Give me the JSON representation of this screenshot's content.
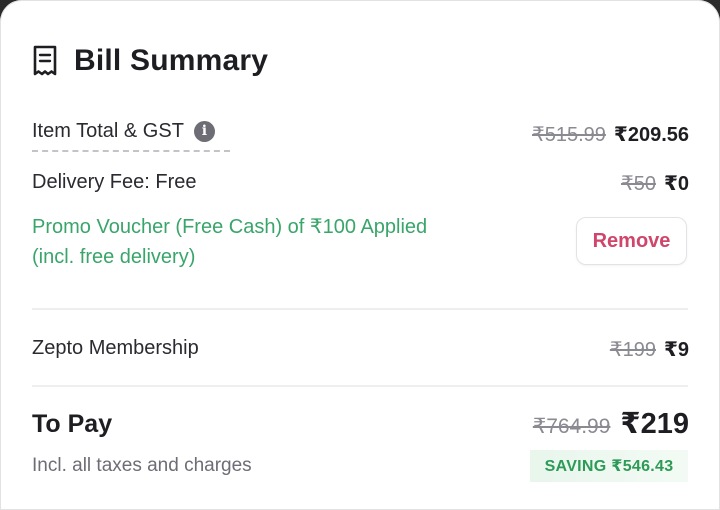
{
  "header": {
    "title": "Bill Summary",
    "icon": "receipt-icon"
  },
  "item_total": {
    "label": "Item Total & GST",
    "original": "₹515.99",
    "final": "₹209.56"
  },
  "delivery": {
    "label": "Delivery Fee: Free",
    "original": "₹50",
    "final": "₹0"
  },
  "promo": {
    "line1": "Promo Voucher (Free Cash) of ₹100 Applied",
    "line2": "(incl. free delivery)",
    "remove_label": "Remove"
  },
  "membership": {
    "label": "Zepto Membership",
    "original": "₹199",
    "final": "₹9"
  },
  "to_pay": {
    "label": "To Pay",
    "sub": "Incl. all taxes and charges",
    "original": "₹764.99",
    "final": "₹219",
    "saving": "SAVING ₹546.43"
  },
  "colors": {
    "promo_green": "#3aa56a",
    "remove_pink": "#d0456b",
    "saving_green": "#2e9a57"
  }
}
